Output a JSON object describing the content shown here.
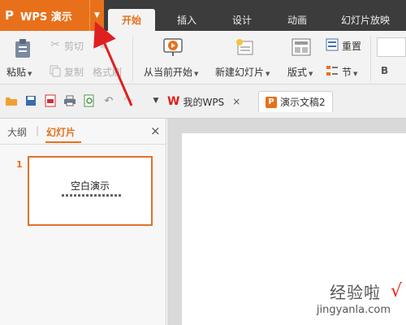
{
  "app": {
    "logo": "P",
    "name": "WPS 演示",
    "dropdown_icon": "caret-down-icon"
  },
  "tabs": [
    {
      "label": "开始",
      "active": true
    },
    {
      "label": "插入",
      "active": false
    },
    {
      "label": "设计",
      "active": false
    },
    {
      "label": "动画",
      "active": false
    },
    {
      "label": "幻灯片放映",
      "active": false
    }
  ],
  "ribbon": {
    "paste": "粘贴",
    "cut": "剪切",
    "copy": "复制",
    "format_painter": "格式刷",
    "from_current": "从当前开始",
    "new_slide": "新建幻灯片",
    "layout": "版式",
    "reset": "重置",
    "section": "节",
    "bold": "B"
  },
  "doc_tabs": [
    {
      "label": "我的WPS",
      "close": "×"
    },
    {
      "label": "演示文稿2"
    }
  ],
  "left_pane": {
    "tab_outline": "大纲",
    "tab_slides": "幻灯片",
    "close": "×",
    "slide_number": "1",
    "slide_title": "空白演示"
  },
  "watermark": {
    "cn": "经验啦",
    "en": "jingyanla.com",
    "check": "√"
  },
  "colors": {
    "accent": "#e8701a",
    "titlebar": "#3c3c3c",
    "arrow": "#e02020"
  }
}
